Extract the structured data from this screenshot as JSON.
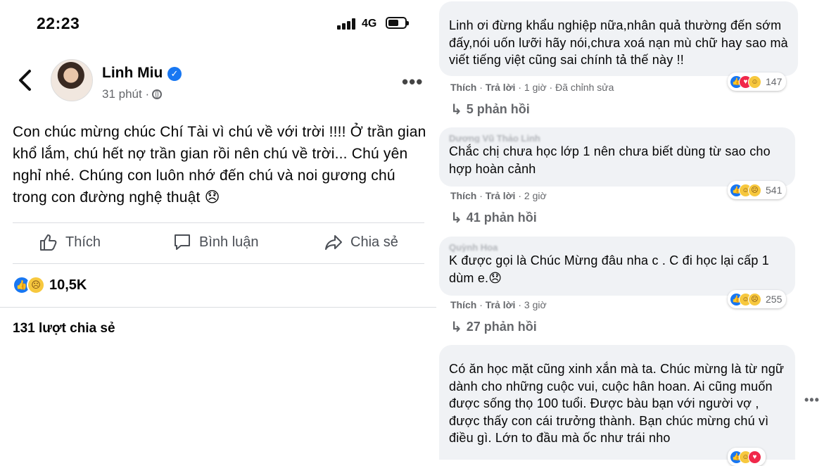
{
  "status_bar": {
    "time": "22:23",
    "network": "4G"
  },
  "post": {
    "author": "Linh Miu",
    "time": "31 phút ·",
    "text": "Con chúc mừng chúc Chí Tài vì chú về với trời !!!! Ở trần gian khổ lắm, chú hết nợ trần gian rồi nên chú về trời... Chú yên nghỉ nhé. Chúng con luôn nhớ đến chú và noi gương chú trong con đường nghệ thuật 😞",
    "actions": {
      "like": "Thích",
      "comment": "Bình luận",
      "share": "Chia sẻ"
    },
    "reaction_count": "10,5K",
    "shares": "131 lượt chia sẻ"
  },
  "comments": [
    {
      "text": "Linh ơi đừng khẩu nghiệp nữa,nhân quả thường đến sớm đấy,nói uốn lưỡi hãy nói,chưa xoá nạn mù chữ hay sao mà viết tiếng việt cũng sai chính tả thế này !!",
      "like": "Thích",
      "reply": "Trả lời",
      "time": "1 giờ",
      "edited": "Đã chỉnh sửa",
      "reactions": "147",
      "replies": "5 phản hồi"
    },
    {
      "name": "Dương Vũ Thảo Linh",
      "text": "Chắc chị chưa học lớp 1 nên chưa biết dùng từ sao cho hợp hoàn cảnh",
      "like": "Thích",
      "reply": "Trả lời",
      "time": "2 giờ",
      "reactions": "541",
      "replies": "41 phản hồi"
    },
    {
      "name": "Quỳnh Hoa",
      "text": "K được gọi là Chúc Mừng đâu nha c . C đi học lại cấp 1 dùm e.😞",
      "like": "Thích",
      "reply": "Trả lời",
      "time": "3 giờ",
      "reactions": "255",
      "replies": "27 phản hồi"
    },
    {
      "text": "Có ăn học mặt cũng xinh xắn mà ta. Chúc mừng là từ ngữ dành cho những cuộc vui, cuộc hân hoan. Ai cũng muốn được sống thọ 100 tuổi. Được bàu bạn với người vợ , được thấy con cái trưởng thành. Bạn chúc mừng chú vì điều gì. Lớn to đầu mà ốc như trái nho"
    }
  ],
  "colors": {
    "accent": "#1877f2",
    "bubble": "#f0f2f5",
    "muted": "#65676b"
  }
}
